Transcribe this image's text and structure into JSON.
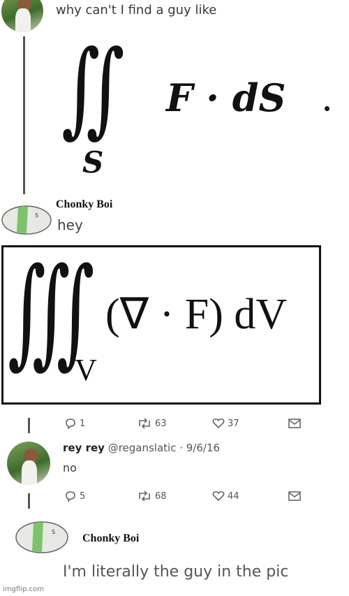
{
  "post1": {
    "text": "why can't I find a guy like"
  },
  "eq1": {
    "integral": "∬",
    "sub": "S",
    "body": "F · dS",
    "end": "."
  },
  "reply1": {
    "name": "Chonky Boi",
    "text": "hey"
  },
  "eq2": {
    "integral": "∭",
    "sub": "V",
    "body": "(∇ · F) dV"
  },
  "actions1": {
    "replies": "1",
    "retweets": "63",
    "likes": "37"
  },
  "reply2": {
    "name": "rey rey",
    "handle": "@reganslatic · 9/6/16",
    "text": "no"
  },
  "actions2": {
    "replies": "5",
    "retweets": "68",
    "likes": "44"
  },
  "reply3": {
    "name": "Chonky Boi",
    "text": "I'm literally the guy in the pic"
  },
  "bean": {
    "letter": "S"
  },
  "watermark": "imgflip.com",
  "colors": {
    "bean_body": "#e8e8e4",
    "bean_band": "#7cc36b",
    "frame": "#111111"
  }
}
